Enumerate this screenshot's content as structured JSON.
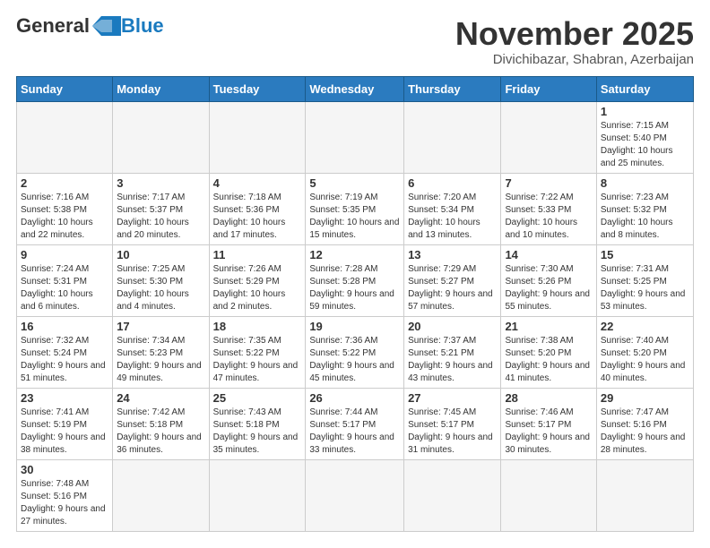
{
  "header": {
    "logo": {
      "general": "General",
      "blue": "Blue"
    },
    "month_title": "November 2025",
    "location": "Divichibazar, Shabran, Azerbaijan"
  },
  "weekdays": [
    "Sunday",
    "Monday",
    "Tuesday",
    "Wednesday",
    "Thursday",
    "Friday",
    "Saturday"
  ],
  "weeks": [
    [
      {
        "day": "",
        "info": ""
      },
      {
        "day": "",
        "info": ""
      },
      {
        "day": "",
        "info": ""
      },
      {
        "day": "",
        "info": ""
      },
      {
        "day": "",
        "info": ""
      },
      {
        "day": "",
        "info": ""
      },
      {
        "day": "1",
        "info": "Sunrise: 7:15 AM\nSunset: 5:40 PM\nDaylight: 10 hours and 25 minutes."
      }
    ],
    [
      {
        "day": "2",
        "info": "Sunrise: 7:16 AM\nSunset: 5:38 PM\nDaylight: 10 hours and 22 minutes."
      },
      {
        "day": "3",
        "info": "Sunrise: 7:17 AM\nSunset: 5:37 PM\nDaylight: 10 hours and 20 minutes."
      },
      {
        "day": "4",
        "info": "Sunrise: 7:18 AM\nSunset: 5:36 PM\nDaylight: 10 hours and 17 minutes."
      },
      {
        "day": "5",
        "info": "Sunrise: 7:19 AM\nSunset: 5:35 PM\nDaylight: 10 hours and 15 minutes."
      },
      {
        "day": "6",
        "info": "Sunrise: 7:20 AM\nSunset: 5:34 PM\nDaylight: 10 hours and 13 minutes."
      },
      {
        "day": "7",
        "info": "Sunrise: 7:22 AM\nSunset: 5:33 PM\nDaylight: 10 hours and 10 minutes."
      },
      {
        "day": "8",
        "info": "Sunrise: 7:23 AM\nSunset: 5:32 PM\nDaylight: 10 hours and 8 minutes."
      }
    ],
    [
      {
        "day": "9",
        "info": "Sunrise: 7:24 AM\nSunset: 5:31 PM\nDaylight: 10 hours and 6 minutes."
      },
      {
        "day": "10",
        "info": "Sunrise: 7:25 AM\nSunset: 5:30 PM\nDaylight: 10 hours and 4 minutes."
      },
      {
        "day": "11",
        "info": "Sunrise: 7:26 AM\nSunset: 5:29 PM\nDaylight: 10 hours and 2 minutes."
      },
      {
        "day": "12",
        "info": "Sunrise: 7:28 AM\nSunset: 5:28 PM\nDaylight: 9 hours and 59 minutes."
      },
      {
        "day": "13",
        "info": "Sunrise: 7:29 AM\nSunset: 5:27 PM\nDaylight: 9 hours and 57 minutes."
      },
      {
        "day": "14",
        "info": "Sunrise: 7:30 AM\nSunset: 5:26 PM\nDaylight: 9 hours and 55 minutes."
      },
      {
        "day": "15",
        "info": "Sunrise: 7:31 AM\nSunset: 5:25 PM\nDaylight: 9 hours and 53 minutes."
      }
    ],
    [
      {
        "day": "16",
        "info": "Sunrise: 7:32 AM\nSunset: 5:24 PM\nDaylight: 9 hours and 51 minutes."
      },
      {
        "day": "17",
        "info": "Sunrise: 7:34 AM\nSunset: 5:23 PM\nDaylight: 9 hours and 49 minutes."
      },
      {
        "day": "18",
        "info": "Sunrise: 7:35 AM\nSunset: 5:22 PM\nDaylight: 9 hours and 47 minutes."
      },
      {
        "day": "19",
        "info": "Sunrise: 7:36 AM\nSunset: 5:22 PM\nDaylight: 9 hours and 45 minutes."
      },
      {
        "day": "20",
        "info": "Sunrise: 7:37 AM\nSunset: 5:21 PM\nDaylight: 9 hours and 43 minutes."
      },
      {
        "day": "21",
        "info": "Sunrise: 7:38 AM\nSunset: 5:20 PM\nDaylight: 9 hours and 41 minutes."
      },
      {
        "day": "22",
        "info": "Sunrise: 7:40 AM\nSunset: 5:20 PM\nDaylight: 9 hours and 40 minutes."
      }
    ],
    [
      {
        "day": "23",
        "info": "Sunrise: 7:41 AM\nSunset: 5:19 PM\nDaylight: 9 hours and 38 minutes."
      },
      {
        "day": "24",
        "info": "Sunrise: 7:42 AM\nSunset: 5:18 PM\nDaylight: 9 hours and 36 minutes."
      },
      {
        "day": "25",
        "info": "Sunrise: 7:43 AM\nSunset: 5:18 PM\nDaylight: 9 hours and 35 minutes."
      },
      {
        "day": "26",
        "info": "Sunrise: 7:44 AM\nSunset: 5:17 PM\nDaylight: 9 hours and 33 minutes."
      },
      {
        "day": "27",
        "info": "Sunrise: 7:45 AM\nSunset: 5:17 PM\nDaylight: 9 hours and 31 minutes."
      },
      {
        "day": "28",
        "info": "Sunrise: 7:46 AM\nSunset: 5:17 PM\nDaylight: 9 hours and 30 minutes."
      },
      {
        "day": "29",
        "info": "Sunrise: 7:47 AM\nSunset: 5:16 PM\nDaylight: 9 hours and 28 minutes."
      }
    ],
    [
      {
        "day": "30",
        "info": "Sunrise: 7:48 AM\nSunset: 5:16 PM\nDaylight: 9 hours and 27 minutes."
      },
      {
        "day": "",
        "info": ""
      },
      {
        "day": "",
        "info": ""
      },
      {
        "day": "",
        "info": ""
      },
      {
        "day": "",
        "info": ""
      },
      {
        "day": "",
        "info": ""
      },
      {
        "day": "",
        "info": ""
      }
    ]
  ]
}
